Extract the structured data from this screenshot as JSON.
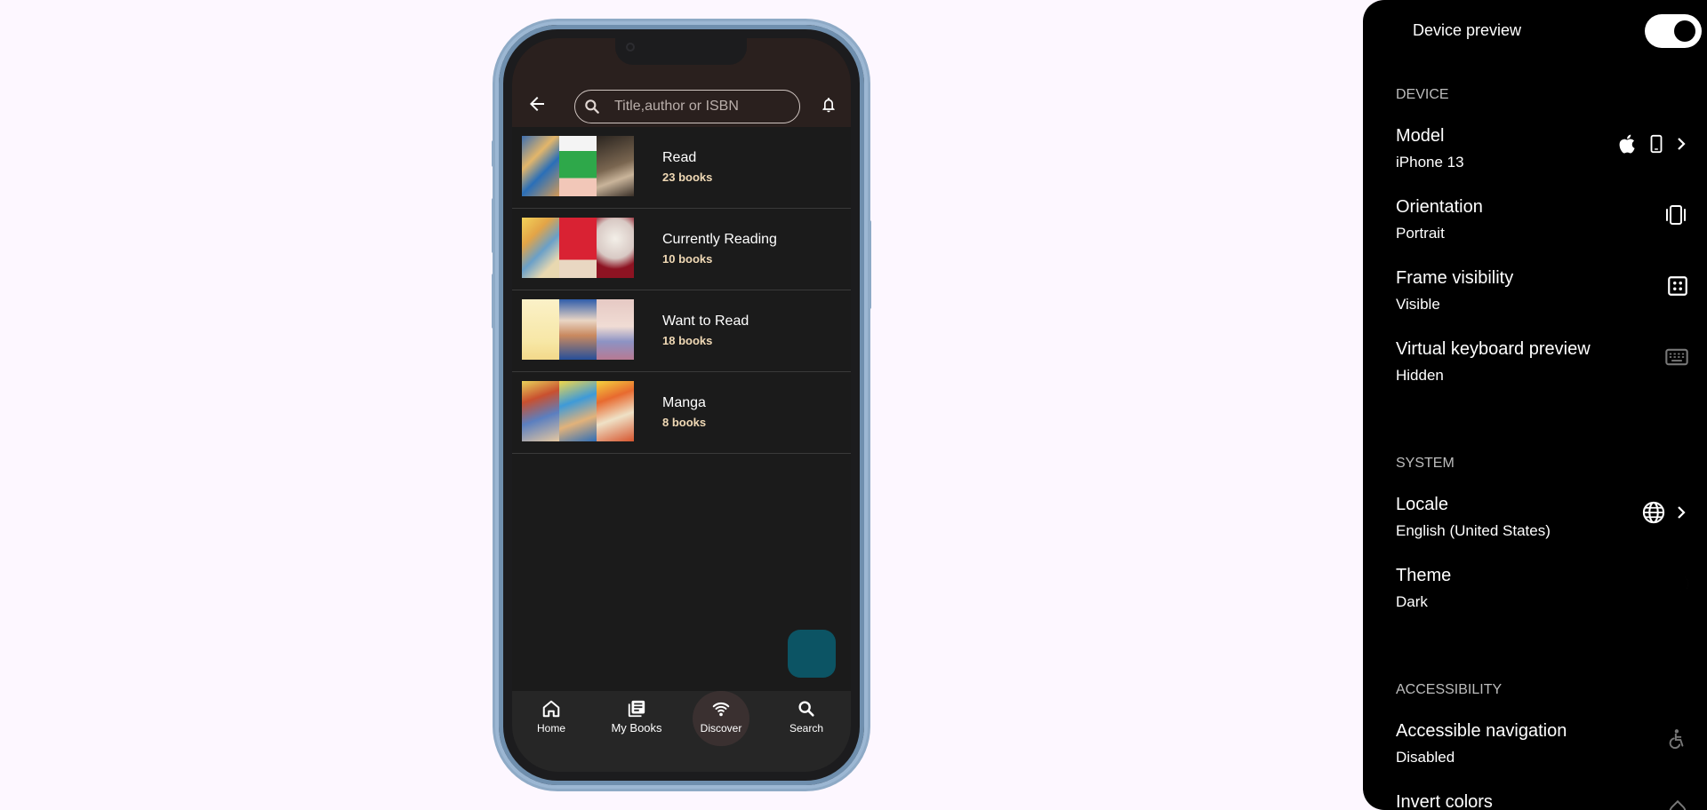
{
  "app": {
    "search": {
      "placeholder": "Title,author or ISBN"
    },
    "shelves": [
      {
        "title": "Read",
        "count": "23 books"
      },
      {
        "title": "Currently Reading",
        "count": "10 books"
      },
      {
        "title": "Want to Read",
        "count": "18 books"
      },
      {
        "title": "Manga",
        "count": "8 books"
      }
    ],
    "nav": [
      {
        "label": "Home",
        "icon": "home-icon"
      },
      {
        "label": "My Books",
        "icon": "library-icon"
      },
      {
        "label": "Discover",
        "icon": "discover-icon",
        "active": true
      },
      {
        "label": "Search",
        "icon": "search-icon"
      }
    ],
    "colors": {
      "appbar": "#2a201e",
      "background": "#1b1b1b",
      "fab": "#0c5464",
      "count_text": "#f0d9b5"
    }
  },
  "panel": {
    "header": "Device preview",
    "toggle_on": true,
    "sections": {
      "device": "DEVICE",
      "system": "SYSTEM",
      "accessibility": "ACCESSIBILITY"
    },
    "rows": {
      "model": {
        "title": "Model",
        "value": "iPhone 13"
      },
      "orientation": {
        "title": "Orientation",
        "value": "Portrait"
      },
      "frame": {
        "title": "Frame visibility",
        "value": "Visible"
      },
      "keyboard": {
        "title": "Virtual keyboard preview",
        "value": "Hidden"
      },
      "locale": {
        "title": "Locale",
        "value": "English (United States)"
      },
      "theme": {
        "title": "Theme",
        "value": "Dark"
      },
      "accessible_nav": {
        "title": "Accessible navigation",
        "value": "Disabled"
      },
      "invert": {
        "title": "Invert colors"
      }
    }
  }
}
